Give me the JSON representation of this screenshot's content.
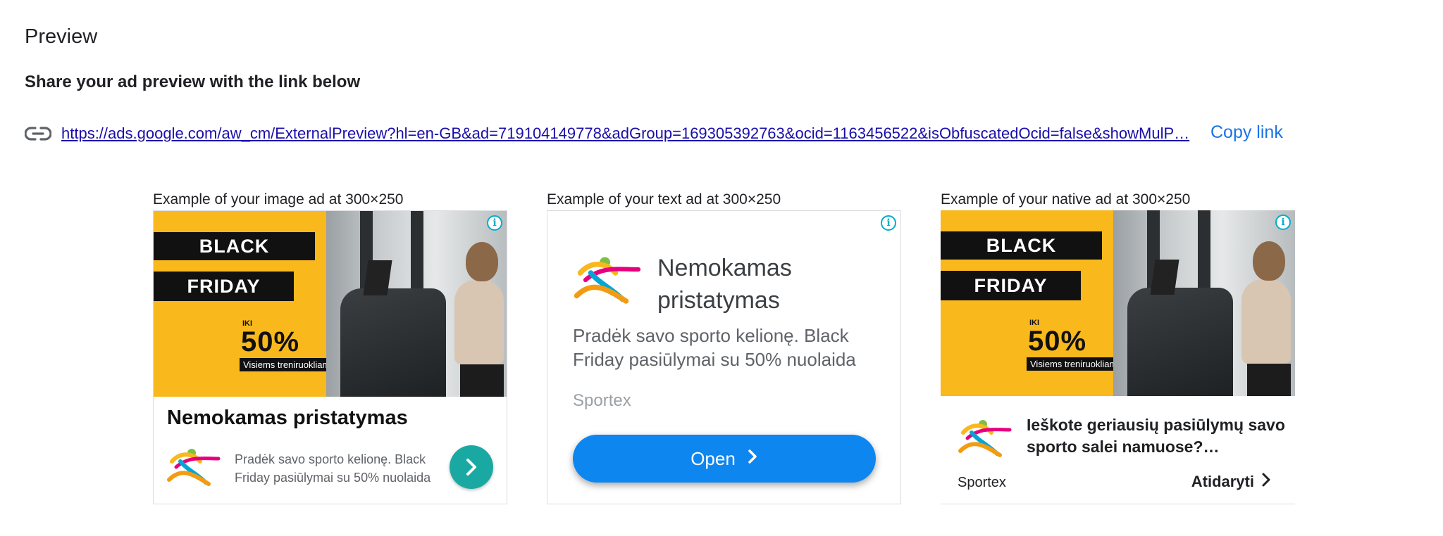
{
  "page": {
    "title": "Preview",
    "share_heading": "Share your ad preview with the link below"
  },
  "link": {
    "icon": "link-icon",
    "url": "https://ads.google.com/aw_cm/ExternalPreview?hl=en-GB&ad=719104149778&adGroup=169305392763&ocid=1163456522&isObfuscatedOcid=false&showMulP…",
    "copy_label": "Copy link"
  },
  "colors": {
    "link": "#1a0dab",
    "accent": "#1a73e8",
    "open_button": "#0e86f0",
    "banner_yellow": "#f9b81c",
    "arrow_teal": "#1aa9a2",
    "info_icon": "#00aecd"
  },
  "ads": {
    "image_ad": {
      "caption": "Example of your image ad at 300×250",
      "banner": {
        "line1": "BLACK",
        "line2": "FRIDAY",
        "iki": "IKI",
        "percent": "50%",
        "sub": "Visiems treniruokliams"
      },
      "headline": "Nemokamas pristatymas",
      "description": "Pradėk savo sporto kelionę. Black Friday pasiūlymai su 50% nuolaida",
      "icons": {
        "info": "info-icon",
        "logo": "sportex-logo-icon",
        "arrow": "chevron-right-icon"
      }
    },
    "text_ad": {
      "caption": "Example of your text ad at 300×250",
      "headline": "Nemokamas pristatymas",
      "description": "Pradėk savo sporto kelionę. Black Friday pasiūlymai su 50% nuolaida",
      "advertiser": "Sportex",
      "button_label": "Open",
      "icons": {
        "info": "info-icon",
        "logo": "sportex-logo-icon",
        "chevron": "chevron-right-icon"
      }
    },
    "native_ad": {
      "caption": "Example of your native ad at 300×250",
      "banner": {
        "line1": "BLACK",
        "line2": "FRIDAY",
        "iki": "IKI",
        "percent": "50%",
        "sub": "Visiems treniruokliams"
      },
      "headline": "Ieškote geriausių pasiūlymų savo sporto salei namuose?…",
      "advertiser": "Sportex",
      "cta_label": "Atidaryti",
      "icons": {
        "info": "info-icon",
        "logo": "sportex-logo-icon",
        "chevron": "chevron-right-icon"
      }
    }
  }
}
